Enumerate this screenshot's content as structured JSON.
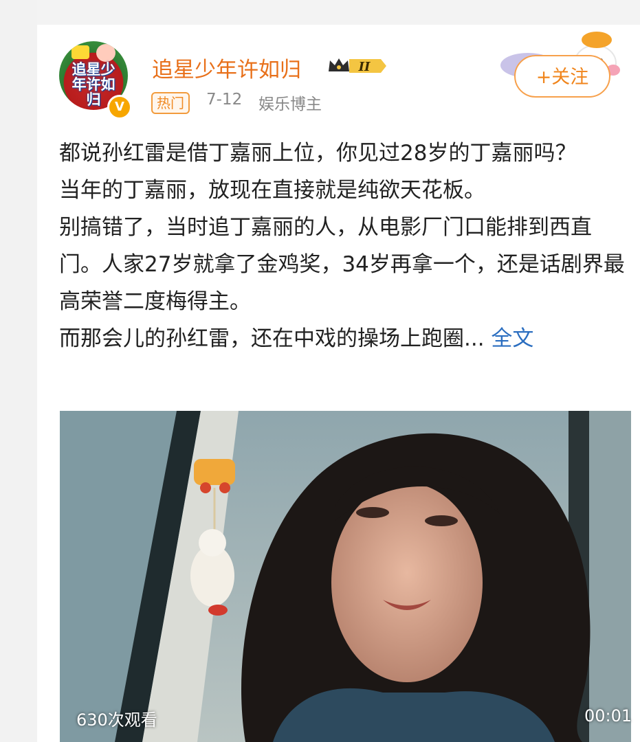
{
  "post": {
    "author": {
      "name": "追星少年许如归",
      "avatar_text": "追星少年许如归",
      "verified_glyph": "V",
      "level_badge": "II"
    },
    "tag": "热门",
    "date": "7-12",
    "category": "娱乐博主",
    "follow_label": "+关注",
    "text_lines": [
      "都说孙红雷是借丁嘉丽上位，你见过28岁的丁嘉丽吗？",
      "当年的丁嘉丽，放现在直接就是纯欲天花板。",
      "别搞错了，当时追丁嘉丽的人，从电影厂门口能排到西直门。人家27岁就拿了金鸡奖，34岁再拿一个，还是话剧界最高荣誉二度梅得主。",
      "而那会儿的孙红雷，还在中戏的操场上跑圈..."
    ],
    "full_text_link": "全文",
    "video": {
      "views": "630次观看",
      "duration": "00:01"
    }
  },
  "colors": {
    "author": "#e8701a",
    "link": "#2b6ec0",
    "follow": "#f0851c"
  }
}
